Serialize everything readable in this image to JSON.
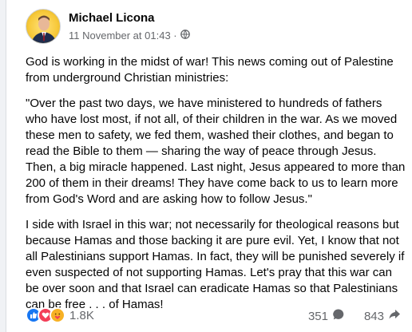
{
  "post": {
    "author": "Michael Licona",
    "timestamp": "11 November at 01:43 ·",
    "privacy_icon": "globe-icon",
    "paragraphs": [
      "God is working in the midst of war! This news coming out of Palestine from underground Christian ministries:",
      "\"Over the past two days, we have ministered to hundreds of fathers who have lost most, if not all, of their children in the war. As we moved these men to safety, we fed them, washed their clothes, and began to read the Bible to them — sharing the way of peace through Jesus. Then, a big miracle happened. Last night, Jesus appeared to more than 200 of them in their dreams! They have come back to us to learn more from God's Word and are asking how to follow Jesus.\"",
      "I side with Israel in this war; not necessarily for theological reasons but because Hamas and those backing it are pure evil. Yet, I know that not all Palestinians support Hamas. In fact, they will be punished severely if even suspected of not supporting Hamas. Let's pray that this war can be over soon and that Israel can eradicate Hamas so that Palestinians can be free . . . of Hamas!"
    ]
  },
  "footer": {
    "reactions": [
      "like-icon",
      "love-icon",
      "care-icon"
    ],
    "reaction_count": "1.8K",
    "comment_count": "351",
    "share_count": "843",
    "colors": {
      "like": "#1877f2",
      "love": "#f33e58",
      "care": "#f7b125"
    }
  }
}
